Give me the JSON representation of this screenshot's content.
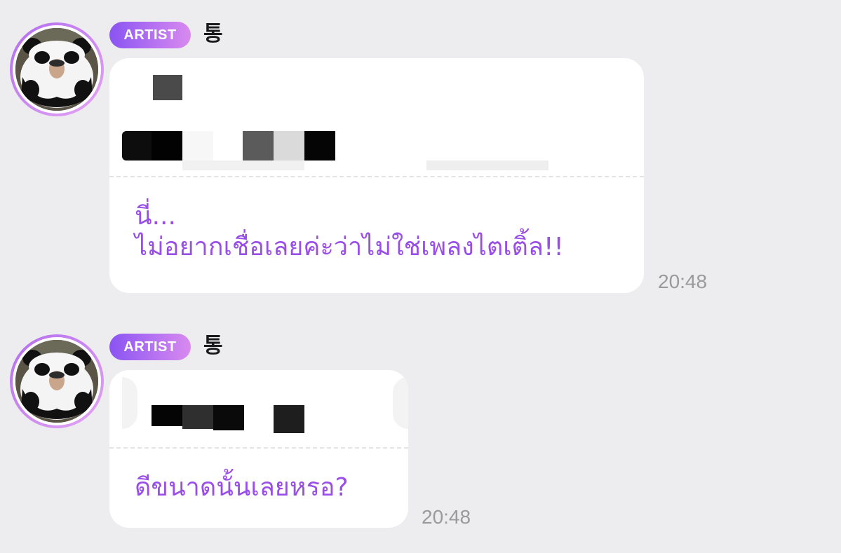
{
  "messages": [
    {
      "badge": "ARTIST",
      "sender": "통",
      "reply_line1": "นี่...",
      "reply_line2": "ไม่อยากเชื่อเลยค่ะว่าไม่ใช่เพลงไตเติ้ล!!",
      "time": "20:48",
      "avatar_icon": "panda-costume-avatar"
    },
    {
      "badge": "ARTIST",
      "sender": "통",
      "reply_line1": "ดีขนาดนั้นเลยหรอ?",
      "time": "20:48",
      "avatar_icon": "panda-costume-avatar"
    }
  ],
  "colors": {
    "background": "#ededef",
    "accent_purple": "#9a4ee8",
    "badge_gradient_start": "#8a54f2",
    "badge_gradient_end": "#d98af0",
    "bubble": "#ffffff",
    "timestamp": "#9a9a9a"
  }
}
